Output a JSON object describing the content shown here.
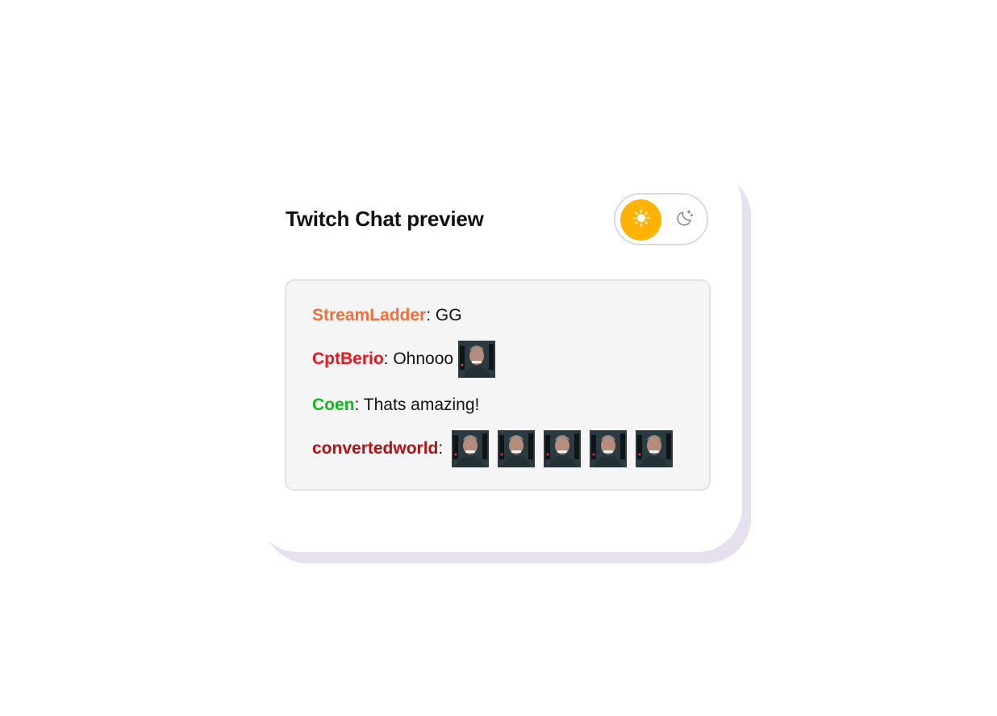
{
  "panel": {
    "title": "Twitch Chat preview"
  },
  "theme_toggle": {
    "active": "light",
    "options": [
      {
        "icon": "sun-icon",
        "mode": "light"
      },
      {
        "icon": "moon-icon",
        "mode": "dark"
      }
    ],
    "accent_color": "#ffb300"
  },
  "chat": {
    "separator": ":",
    "messages": [
      {
        "username": "StreamLadder",
        "color": "#f0703c",
        "text": " GG",
        "emotes": 0
      },
      {
        "username": "CptBerio",
        "color": "#e8141e",
        "text": " Ohnooo",
        "emotes": 1
      },
      {
        "username": "Coen",
        "color": "#0fbb1e",
        "text": " Thats amazing!",
        "emotes": 0
      },
      {
        "username": "convertedworld",
        "color": "#b31212",
        "text": "",
        "emotes": 5
      }
    ]
  }
}
